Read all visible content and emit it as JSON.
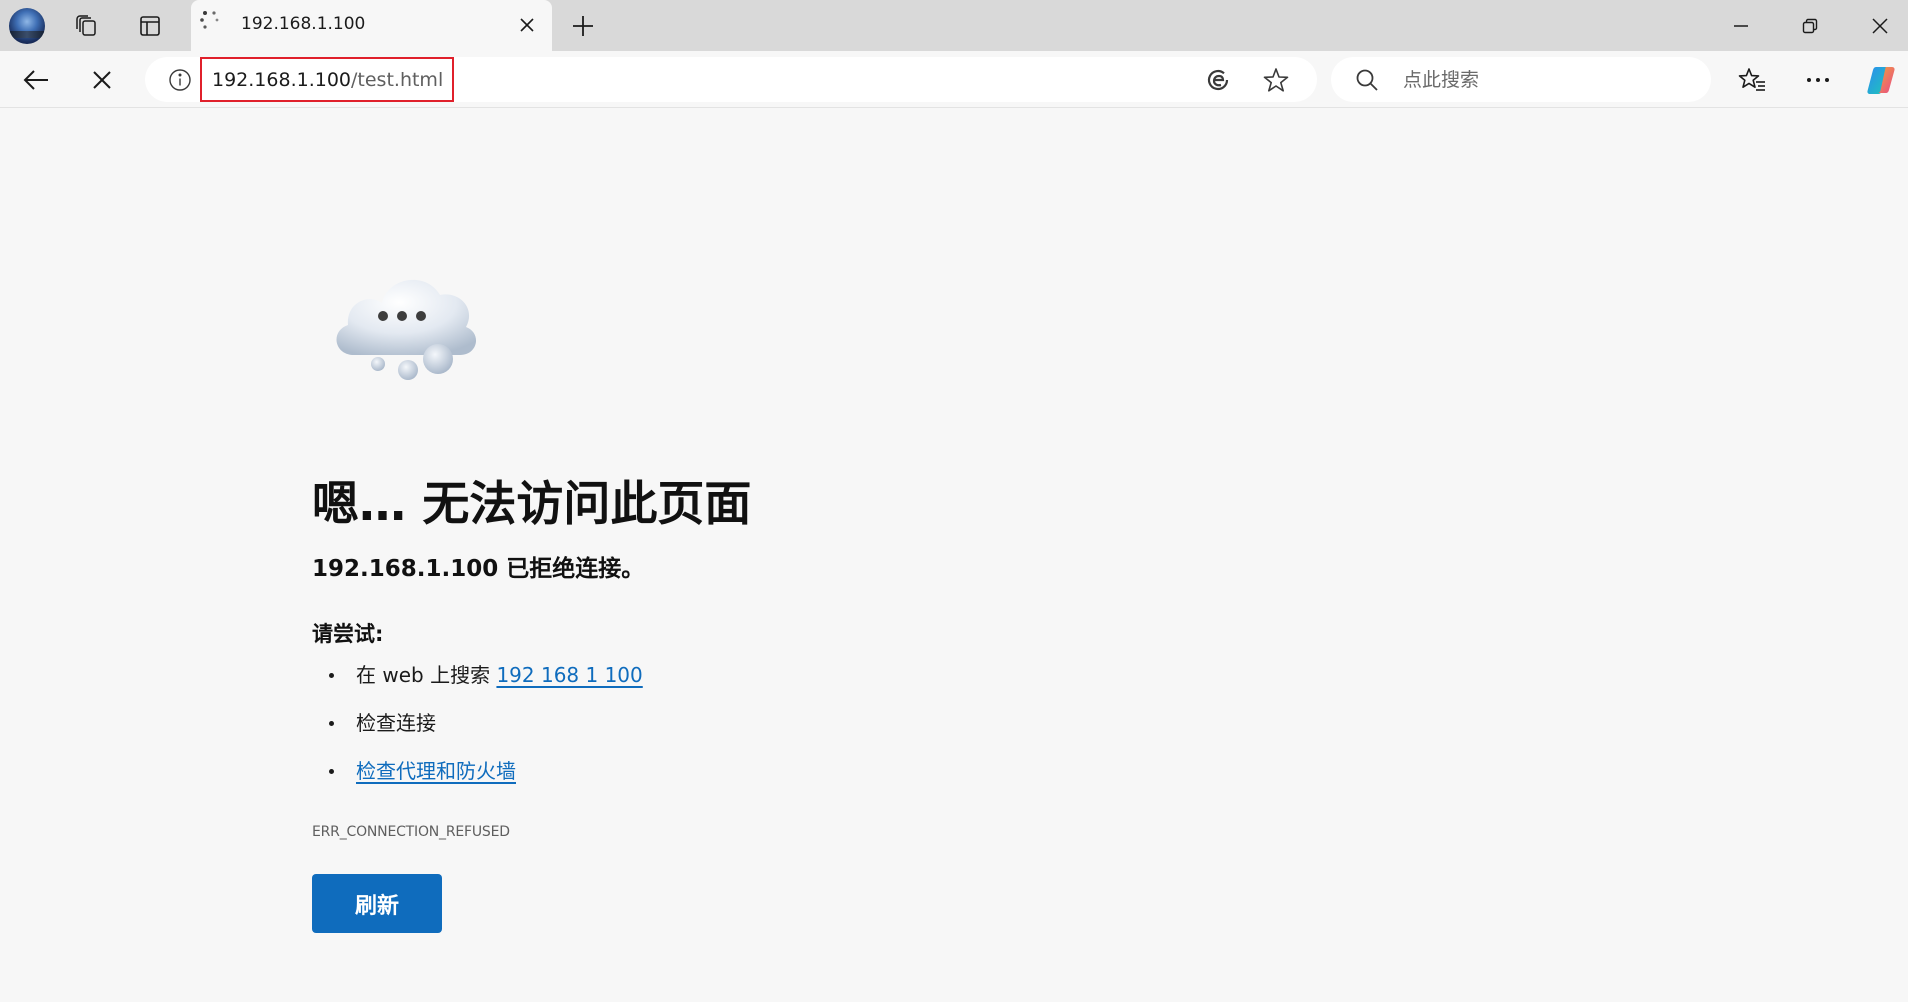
{
  "tab": {
    "title": "192.168.1.100"
  },
  "address_bar": {
    "url_host": "192.168.1.100",
    "url_path": "/test.html"
  },
  "search": {
    "placeholder": "点此搜索"
  },
  "icons": {
    "profile": "profile-avatar",
    "workspaces": "workspaces-icon",
    "vertical_tabs": "vertical-tabs-icon",
    "tab_loading": "loading-spinner-icon",
    "tab_close": "close-icon",
    "new_tab": "plus-icon",
    "minimize": "minimize-icon",
    "restore": "restore-icon",
    "window_close": "close-icon",
    "back": "arrow-left-icon",
    "stop": "stop-icon",
    "site_info": "info-icon",
    "read_aloud": "edge-refresh-icon",
    "favorite": "star-icon",
    "search": "search-icon",
    "favorites": "favorites-list-icon",
    "more": "more-icon",
    "copilot": "copilot-icon",
    "cloud": "cloud-error-illustration"
  },
  "colors": {
    "accent": "#0f6cbd",
    "highlight_box": "#e0202b",
    "background": "#f7f7f7",
    "tabstrip": "#d9d9d9"
  },
  "page": {
    "title": "嗯… 无法访问此页面",
    "subtitle": "192.168.1.100 已拒绝连接。",
    "try_heading": "请尝试:",
    "suggestions": [
      {
        "prefix": "在 web 上搜索 ",
        "link": "192 168 1 100"
      },
      {
        "text": "检查连接"
      },
      {
        "link": "检查代理和防火墙"
      }
    ],
    "error_code": "ERR_CONNECTION_REFUSED",
    "refresh_label": "刷新"
  }
}
